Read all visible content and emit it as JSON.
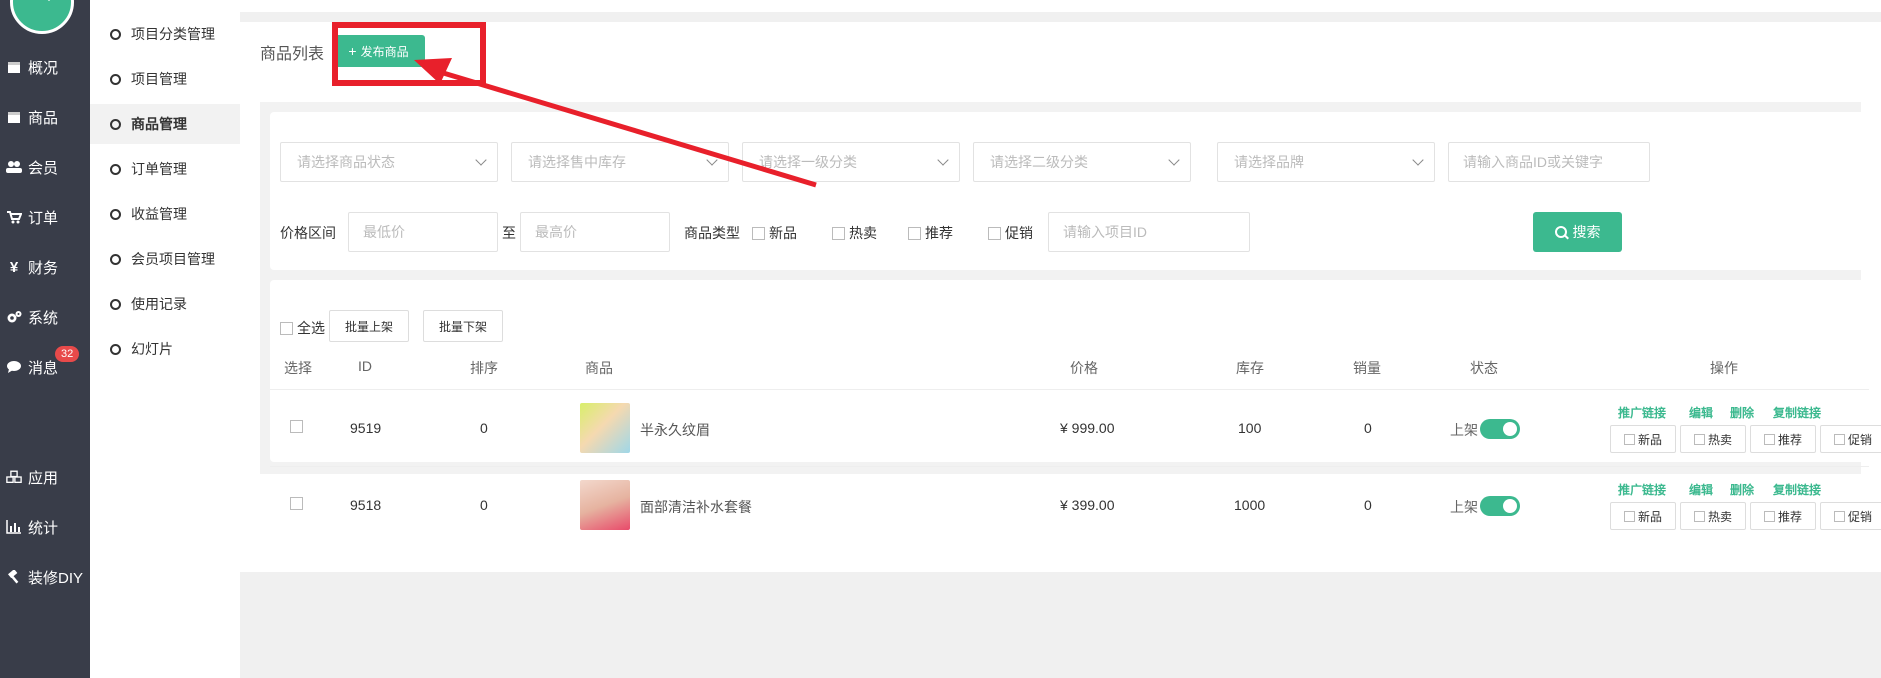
{
  "nav": {
    "items": [
      {
        "label": "概况",
        "icon": "calendar-icon"
      },
      {
        "label": "商品",
        "icon": "calendar-icon"
      },
      {
        "label": "会员",
        "icon": "users-icon"
      },
      {
        "label": "订单",
        "icon": "cart-icon"
      },
      {
        "label": "财务",
        "icon": "yen-icon"
      },
      {
        "label": "系统",
        "icon": "gears-icon"
      },
      {
        "label": "消息",
        "icon": "chat-icon",
        "badge": "32"
      },
      {
        "label": "应用",
        "icon": "cubes-icon"
      },
      {
        "label": "统计",
        "icon": "bar-chart-icon"
      },
      {
        "label": "装修DIY",
        "icon": "hammer-icon"
      }
    ]
  },
  "submenu": {
    "items": [
      "项目分类管理",
      "项目管理",
      "商品管理",
      "订单管理",
      "收益管理",
      "会员项目管理",
      "使用记录",
      "幻灯片"
    ],
    "active": "商品管理"
  },
  "header": {
    "title": "商品列表",
    "publish_label": "发布商品"
  },
  "filters": {
    "status_placeholder": "请选择商品状态",
    "stock_placeholder": "请选择售中库存",
    "cat1_placeholder": "请选择一级分类",
    "cat2_placeholder": "请选择二级分类",
    "brand_placeholder": "请选择品牌",
    "keyword_placeholder": "请输入商品ID或关键字",
    "price_label": "价格区间",
    "min_placeholder": "最低价",
    "to_label": "至",
    "max_placeholder": "最高价",
    "type_label": "商品类型",
    "types": [
      "新品",
      "热卖",
      "推荐",
      "促销"
    ],
    "project_placeholder": "请输入项目ID",
    "search_label": "搜索"
  },
  "bulk": {
    "select_all": "全选",
    "on_shelf": "批量上架",
    "off_shelf": "批量下架"
  },
  "table": {
    "headers": [
      "选择",
      "ID",
      "排序",
      "商品",
      "价格",
      "库存",
      "销量",
      "状态",
      "操作"
    ],
    "rows": [
      {
        "id": "9519",
        "sort": "0",
        "name": "半永久纹眉",
        "price": "¥ 999.00",
        "stock": "100",
        "sales": "0",
        "status": "上架"
      },
      {
        "id": "9518",
        "sort": "0",
        "name": "面部清洁补水套餐",
        "price": "¥ 399.00",
        "stock": "1000",
        "sales": "0",
        "status": "上架"
      }
    ],
    "op_links": [
      "推广链接",
      "编辑",
      "删除",
      "复制链接"
    ],
    "op_tags": [
      "新品",
      "热卖",
      "推荐",
      "促销"
    ]
  },
  "colors": {
    "sidebar": "#393d49",
    "accent": "#3cb98f",
    "highlight": "#e8202b",
    "badge": "#e84a4a"
  }
}
